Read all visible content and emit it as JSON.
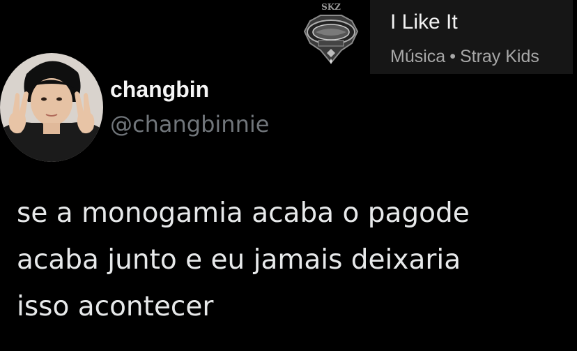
{
  "music": {
    "title": "I Like It",
    "category": "Música",
    "separator": "•",
    "artist": "Stray Kids",
    "album_art_lettering": "SKZ"
  },
  "profile": {
    "display_name": "changbin",
    "handle": "@changbinnie"
  },
  "post": {
    "lines": [
      "se a monogamia acaba o pagode",
      "acaba junto e eu jamais deixaria",
      "isso acontecer"
    ]
  }
}
